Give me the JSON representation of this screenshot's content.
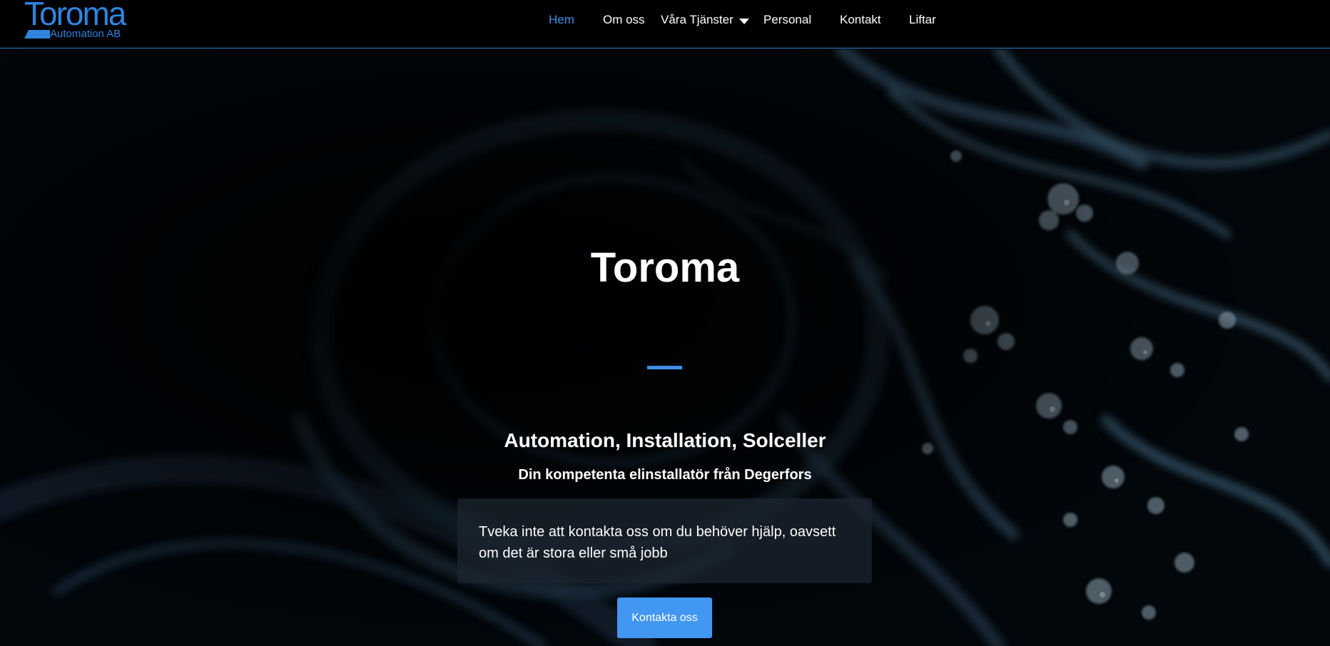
{
  "brand": {
    "logo_main": "Toroma",
    "logo_sub": "Automation AB",
    "accent_color": "#3f8fe3"
  },
  "nav": {
    "items": [
      {
        "label": "Hem",
        "active": true
      },
      {
        "label": "Om oss"
      },
      {
        "label": "Våra Tjänster",
        "has_dropdown": true
      },
      {
        "label": "Personal"
      },
      {
        "label": "Kontakt"
      },
      {
        "label": "Liftar"
      }
    ]
  },
  "hero": {
    "title": "Toroma",
    "subtitle": "Automation, Installation, Solceller",
    "tagline": "Din kompetenta elinstallatör från Degerfors",
    "info_text": "Tveka inte att kontakta oss om du behöver hjälp, oavsett om det är stora eller små jobb",
    "cta_label": "Kontakta oss",
    "cta_color": "#4297f2"
  }
}
